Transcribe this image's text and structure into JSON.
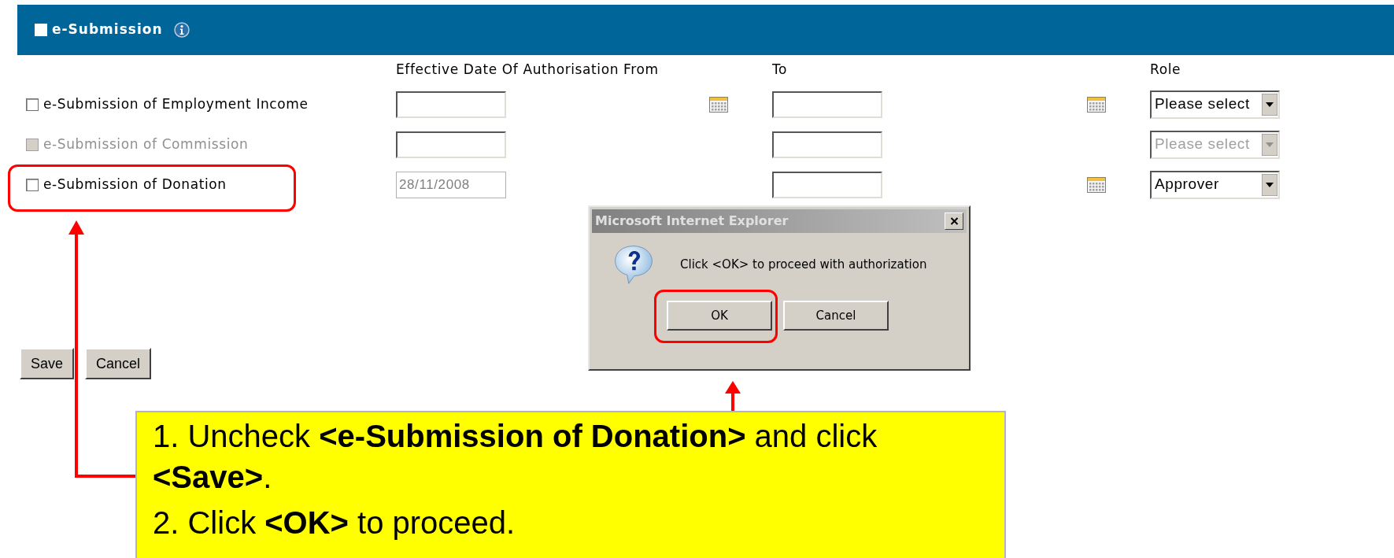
{
  "section": {
    "title": "e-Submission",
    "checked": false
  },
  "columns": [
    "Effective Date Of Authorisation From",
    "To",
    "Role"
  ],
  "rows": [
    {
      "label": "e-Submission of Employment Income",
      "checked": false,
      "disabled": false,
      "highlighted": false,
      "from_calendar": true,
      "to_calendar": true,
      "role": "Please select"
    },
    {
      "label": "e-Submission of Commission",
      "checked": false,
      "disabled": true,
      "highlighted": false,
      "from_calendar": false,
      "to_calendar": false,
      "role": "Please select"
    },
    {
      "label": "e-Submission of Donation",
      "checked": false,
      "disabled": false,
      "highlighted": true,
      "from": "28/11/2008",
      "from_locked": true,
      "from_calendar": false,
      "to_calendar": true,
      "role": "Approver"
    }
  ],
  "buttons": [
    "Save",
    "Cancel"
  ],
  "dialog": {
    "title": "Microsoft Internet Explorer",
    "message": "Click <OK> to proceed with authorization",
    "buttons": [
      {
        "label": "OK",
        "highlighted": true
      },
      {
        "label": "Cancel",
        "highlighted": false
      }
    ]
  },
  "callout": [
    "1. Uncheck **<e-Submission of Donation>** and click **<Save>**.",
    "2. Click **<OK>** to proceed."
  ]
}
